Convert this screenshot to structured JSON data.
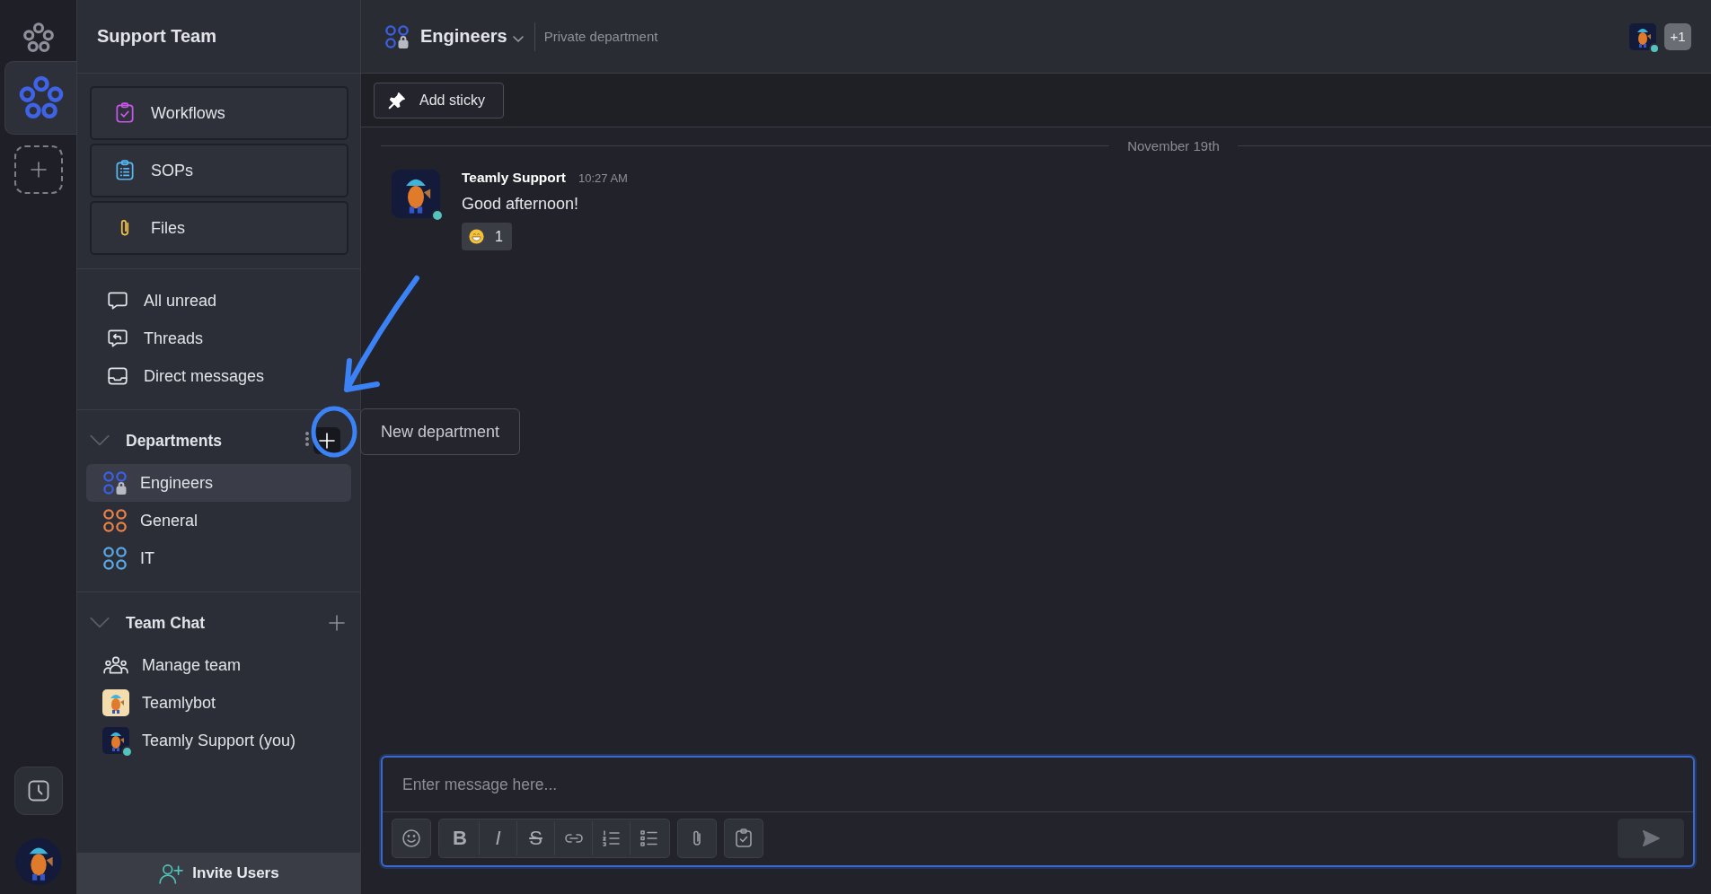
{
  "rail": {
    "workspaces": [
      {
        "selected": true
      }
    ]
  },
  "sidebar": {
    "title": "Support Team",
    "tools": [
      {
        "label": "Workflows",
        "kind": "workflows"
      },
      {
        "label": "SOPs",
        "kind": "sops"
      },
      {
        "label": "Files",
        "kind": "files"
      }
    ],
    "nav": [
      {
        "label": "All unread",
        "kind": "unread"
      },
      {
        "label": "Threads",
        "kind": "threads"
      },
      {
        "label": "Direct messages",
        "kind": "dm"
      }
    ],
    "departments": {
      "title": "Departments",
      "expanded": true,
      "items": [
        {
          "label": "Engineers",
          "color": "#3d5fe3",
          "locked": true,
          "selected": true
        },
        {
          "label": "General",
          "color": "#e8814a",
          "locked": false,
          "selected": false
        },
        {
          "label": "IT",
          "color": "#5aa9e6",
          "locked": false,
          "selected": false
        }
      ]
    },
    "team_chat": {
      "title": "Team Chat",
      "expanded": true,
      "items": [
        {
          "label": "Manage team",
          "kind": "team",
          "online": false
        },
        {
          "label": "Teamlybot",
          "kind": "bot",
          "online": false
        },
        {
          "label": "Teamly Support (you)",
          "kind": "user",
          "online": true
        }
      ]
    },
    "invite": "Invite Users"
  },
  "tooltip": "New department",
  "channel": {
    "name": "Engineers",
    "description": "Private department",
    "member_online": true,
    "members_more": "+1"
  },
  "sticky_button": "Add sticky",
  "date_divider": "November 19th",
  "messages": [
    {
      "author": "Teamly Support",
      "time": "10:27 AM",
      "text": "Good afternoon!",
      "online": true,
      "reactions": [
        {
          "count": "1"
        }
      ]
    }
  ],
  "composer": {
    "placeholder": "Enter message here...",
    "groups": [
      [
        {
          "kind": "emoji"
        }
      ],
      [
        {
          "kind": "bold",
          "glyph": "B"
        },
        {
          "kind": "italic",
          "glyph": "I"
        },
        {
          "kind": "strike",
          "glyph": "S"
        },
        {
          "kind": "link"
        },
        {
          "kind": "ordered"
        },
        {
          "kind": "bullets"
        }
      ],
      [
        {
          "kind": "attach"
        }
      ],
      [
        {
          "kind": "task"
        }
      ]
    ]
  }
}
